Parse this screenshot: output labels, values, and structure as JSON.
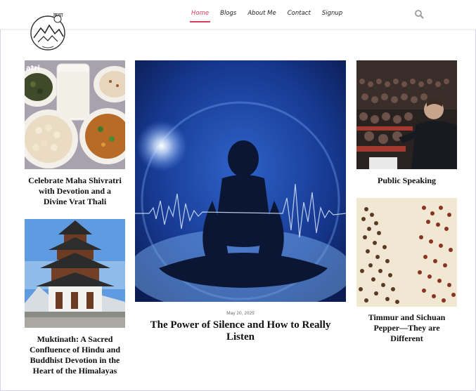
{
  "header": {
    "nav": [
      {
        "label": "Home",
        "active": true
      },
      {
        "label": "Blogs",
        "active": false
      },
      {
        "label": "About Me",
        "active": false
      },
      {
        "label": "Contact",
        "active": false
      },
      {
        "label": "Signup",
        "active": false
      }
    ],
    "search_icon": "search-icon",
    "logo_text": "कथा"
  },
  "colors": {
    "accent": "#d63c5d",
    "text": "#111111",
    "date": "#666666"
  },
  "posts": {
    "shivratri": {
      "title": "Celebrate Maha Shivratri with Devotion and a Divine Vrat Thali",
      "image_text": "atri"
    },
    "muktinath": {
      "title": "Muktinath: A Sacred Confluence of Hindu and Buddhist Devotion in the Heart of the Himalayas"
    },
    "featured": {
      "date": "May 20, 2025",
      "title": "The Power of Silence and How to Really Listen"
    },
    "speaking": {
      "title": "Public Speaking"
    },
    "timmur": {
      "title": "Timmur and Sichuan Pepper—They are Different"
    }
  }
}
